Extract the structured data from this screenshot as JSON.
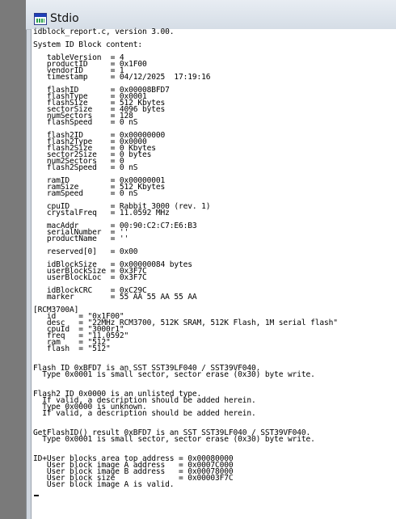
{
  "window": {
    "title": "Stdio",
    "icon": "stdio-window-icon"
  },
  "console": {
    "lines": [
      "idblock_report.c, version 3.00.",
      "",
      "System ID Block content:",
      "",
      "   tableVersion  = 4",
      "   productID     = 0x1F00",
      "   vendorID      = 1",
      "   timestamp     = 04/12/2025  17:19:16",
      "",
      "   flashID       = 0x00008BFD7",
      "   flashType     = 0x0001",
      "   flashSize     = 512 Kbytes",
      "   sectorSize    = 4096 bytes",
      "   numSectors    = 128",
      "   flashSpeed    = 0 nS",
      "",
      "   flash2ID      = 0x00000000",
      "   flash2Type    = 0x0000",
      "   flash2Size    = 0 Kbytes",
      "   sector2Size   = 0 bytes",
      "   num2Sectors   = 0",
      "   flash2Speed   = 0 nS",
      "",
      "   ramID         = 0x00000001",
      "   ramSize       = 512 Kbytes",
      "   ramSpeed      = 0 nS",
      "",
      "   cpuID         = Rabbit 3000 (rev. 1)",
      "   crystalFreq   = 11.0592 MHz",
      "",
      "   macAddr       = 00:90:C2:C7:E6:B3",
      "   serialNumber  = ''",
      "   productName   = ''",
      "",
      "   reserved[0]   = 0x00",
      "",
      "   idBlockSize   = 0x00000084 bytes",
      "   userBlockSize = 0x3F7C",
      "   userBlockLoc  = 0x3F7C",
      "",
      "   idBlockCRC    = 0xC29C",
      "   marker        = 55 AA 55 AA 55 AA",
      "",
      "[RCM3700A]",
      "   id     = \"0x1F00\"",
      "   desc   = \"22MHz RCM3700, 512K SRAM, 512K Flash, 1M serial flash\"",
      "   cpuId  = \"3000r1\"",
      "   freq   = \"11.0592\"",
      "   ram    = \"512\"",
      "   flash  = \"512\"",
      "",
      "",
      "Flash ID 0xBFD7 is an SST SST39LF040 / SST39VF040.",
      "  Type 0x0001 is small sector, sector erase (0x30) byte write.",
      "",
      "",
      "Flash2 ID 0x0000 is an unlisted type.",
      "  If valid, a description should be added herein.",
      "  Type 0x0000 is unknown.",
      "  If valid, a description should be added herein.",
      "",
      "",
      "GetFlashID() result 0xBFD7 is an SST SST39LF040 / SST39VF040.",
      "  Type 0x0001 is small sector, sector erase (0x30) byte write.",
      "",
      "",
      "ID+User blocks area top address = 0x00080000",
      "   User block image A address   = 0x0007C000",
      "   User block image B address   = 0x00078000",
      "   User block size              = 0x00003F7C",
      "   User block image A is valid."
    ]
  }
}
